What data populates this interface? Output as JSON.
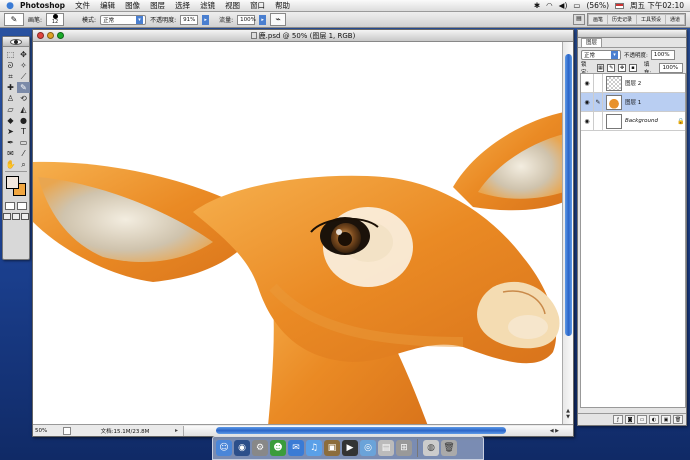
{
  "menubar": {
    "app_name": "Photoshop",
    "items": [
      "文件",
      "编辑",
      "图像",
      "图层",
      "选择",
      "滤镜",
      "视图",
      "窗口",
      "帮助"
    ],
    "battery": "(56%)",
    "clock": "周五 下午02:10"
  },
  "options_bar": {
    "brush_label": "画笔:",
    "brush_size": "12",
    "mode_label": "模式:",
    "mode_value": "正常",
    "opacity_label": "不透明度:",
    "opacity_value": "91%",
    "flow_label": "流量:",
    "flow_value": "100%",
    "palette_tabs": [
      "画笔",
      "历史记录",
      "工具预设",
      "通道"
    ]
  },
  "document": {
    "title": "鹿.psd @ 50% (图层 1, RGB)",
    "zoom": "50%",
    "doc_info": "文档:15.1M/23.8M"
  },
  "layers_panel": {
    "tab": "图层",
    "blend_mode": "正常",
    "opacity_label": "不透明度:",
    "opacity_value": "100%",
    "lock_label": "锁定:",
    "fill_label": "填充:",
    "fill_value": "100%",
    "layers": [
      {
        "name": "图层 2"
      },
      {
        "name": "图层 1"
      },
      {
        "name": "Background"
      }
    ]
  },
  "colors": {
    "foreground": "#f3e8de",
    "background": "#f0a640",
    "accent": "#2a64c8"
  }
}
